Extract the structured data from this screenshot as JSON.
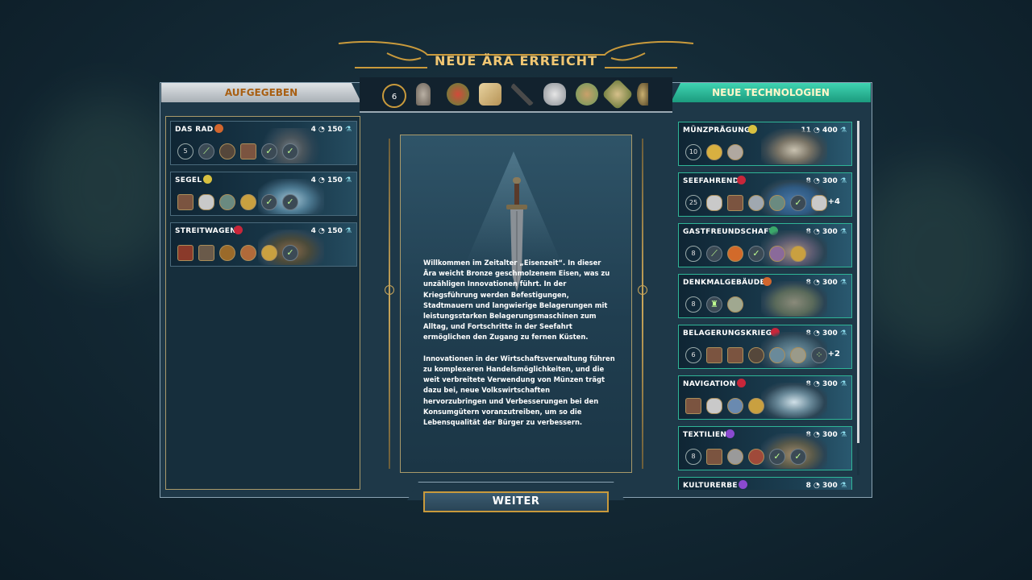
{
  "title": "NEUE ÄRA ERREICHT",
  "left_header": "AUFGEGEBEN",
  "right_header": "NEUE TECHNOLOGIEN",
  "era_badge": "6",
  "era_icons": [
    "laurel-icon",
    "statue-icon",
    "food-icon",
    "map-icon",
    "tools-icon",
    "pot-icon",
    "building-icon",
    "shield-icon",
    "helmet-icon"
  ],
  "abandoned": [
    {
      "name": "DAS RAD",
      "turns": "4",
      "science": "150",
      "badge_color": "#d2662e",
      "laurel": "5"
    },
    {
      "name": "SEGEL",
      "turns": "4",
      "science": "150",
      "badge_color": "#d8c040",
      "laurel": ""
    },
    {
      "name": "STREITWAGEN",
      "turns": "4",
      "science": "150",
      "badge_color": "#c8263a",
      "laurel": ""
    }
  ],
  "new_techs": [
    {
      "name": "MÜNZPRÄGUNG",
      "turns": "11",
      "science": "400",
      "badge_color": "#d8c040",
      "laurel": "10",
      "extra": ""
    },
    {
      "name": "SEEFAHREND",
      "turns": "8",
      "science": "300",
      "badge_color": "#c8263a",
      "laurel": "25",
      "extra": "+4"
    },
    {
      "name": "GASTFREUNDSCHAFT",
      "turns": "8",
      "science": "300",
      "badge_color": "#3aa86a",
      "laurel": "8",
      "extra": ""
    },
    {
      "name": "DENKMALGEBÄUDE",
      "turns": "8",
      "science": "300",
      "badge_color": "#d2662e",
      "laurel": "8",
      "extra": ""
    },
    {
      "name": "BELAGERUNGSKRIEG",
      "turns": "8",
      "science": "300",
      "badge_color": "#c8263a",
      "laurel": "6",
      "extra": "+2"
    },
    {
      "name": "NAVIGATION",
      "turns": "8",
      "science": "300",
      "badge_color": "#c8263a",
      "laurel": "",
      "extra": ""
    },
    {
      "name": "TEXTILIEN",
      "turns": "8",
      "science": "300",
      "badge_color": "#8a4ad0",
      "laurel": "8",
      "extra": ""
    },
    {
      "name": "KULTURERBE",
      "turns": "8",
      "science": "300",
      "badge_color": "#8a4ad0",
      "laurel": "",
      "extra": ""
    }
  ],
  "center_text": "Willkommen im Zeitalter „Eisenzeit“. In dieser Ära weicht Bronze geschmolzenem Eisen, was zu unzähligen Innovationen führt. In der Kriegsführung werden Befestigungen, Stadtmauern und langwierige Belagerungen mit leistungsstarken Belagerungsmaschinen zum Alltag, und Fortschritte in der Seefahrt ermöglichen den Zugang zu fernen Küsten.\n\nInnovationen in der Wirtschaftsverwaltung führen zu komplexeren Handelsmöglichkeiten, und die weit verbreitete Verwendung von Münzen trägt dazu bei, neue Volkswirtschaften hervorzubringen und Verbesserungen bei den Konsumgütern voranzutreiben, um so die Lebensqualität der Bürger zu verbessern.",
  "continue_label": "WEITER",
  "colors": {
    "gold": "#f1c773",
    "teal": "#2fb597",
    "frame": "#1e3848"
  }
}
